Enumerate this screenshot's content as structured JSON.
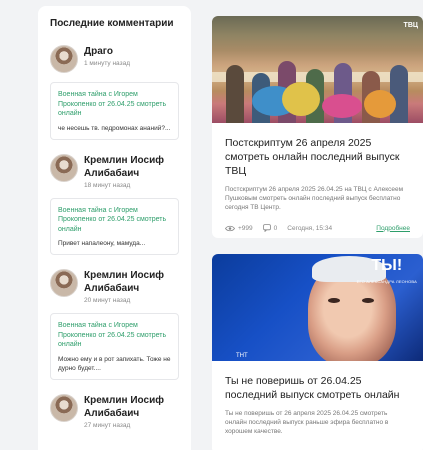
{
  "sidebar": {
    "title": "Последние комментарии",
    "comments": [
      {
        "author": "Драго",
        "time": "1 минуту назад",
        "link": "Военная тайна с Игорем Прокопенко от 26.04.25 смотреть онлайн",
        "text": "че несешь тв. педромонах ананий?..."
      },
      {
        "author": "Кремлин Иосиф Алибабаич",
        "time": "18 минут назад",
        "link": "Военная тайна с Игорем Прокопенко от 26.04.25 смотреть онлайн",
        "text": "Привет напалеону, мамуда..."
      },
      {
        "author": "Кремлин Иосиф Алибабаич",
        "time": "20 минут назад",
        "link": "Военная тайна с Игорем Прокопенко от 26.04.25 смотреть онлайн",
        "text": "Можно ему и в рот запихать. Тоже не дурно будет...."
      },
      {
        "author": "Кремлин Иосиф Алибабаич",
        "time": "27 минут назад",
        "link": "",
        "text": ""
      }
    ]
  },
  "cards": [
    {
      "image_logo": "ТВЦ",
      "title": "Постскриптум 26 апреля 2025 смотреть онлайн последний выпуск ТВЦ",
      "desc": "Постскриптум 26 апреля 2025 26.04.25 на ТВЦ с Алексеем Пушковым смотреть онлайн последний выпуск бесплатно сегодня ТВ Центр.",
      "views": "+999",
      "comments": "0",
      "date": "Сегодня, 15:34",
      "more": "Подробнее"
    },
    {
      "image_logo": "ТЫ!",
      "image_logo_sub": "ЕГО АЛЕКСАНДРА ЛЕОНОВА",
      "image_watermark": "ТНТ",
      "title": "Ты не поверишь от 26.04.25 последний выпуск смотреть онлайн",
      "desc": "Ты не поверишь от 26 апреля 2025 26.04.25 смотреть онлайн последний выпуск раньше эфира бесплатно в хорошем качестве."
    }
  ],
  "colors": {
    "accent": "#2e9e6b",
    "background": "#f2f3f5"
  },
  "icons": [
    "eye-icon",
    "comment-icon"
  ]
}
